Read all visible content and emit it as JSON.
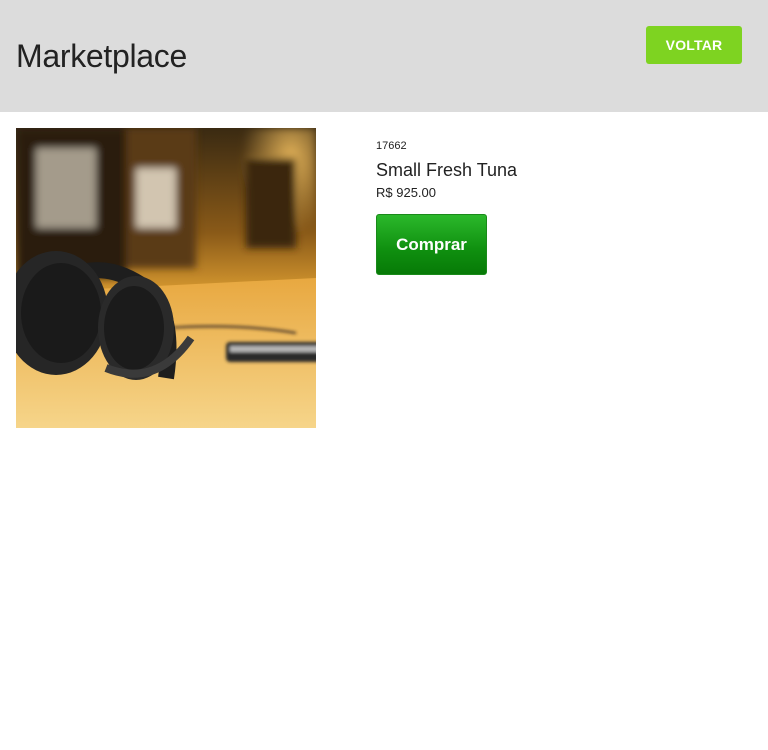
{
  "header": {
    "title": "Marketplace",
    "back_label": "VOLTAR"
  },
  "product": {
    "id": "17662",
    "name": "Small Fresh Tuna",
    "price": "R$ 925.00",
    "buy_label": "Comprar",
    "image_icon": "headphones-photo"
  },
  "colors": {
    "header_bg": "#dcdcdc",
    "back_button": "#7ed321",
    "buy_button": "#139613"
  }
}
